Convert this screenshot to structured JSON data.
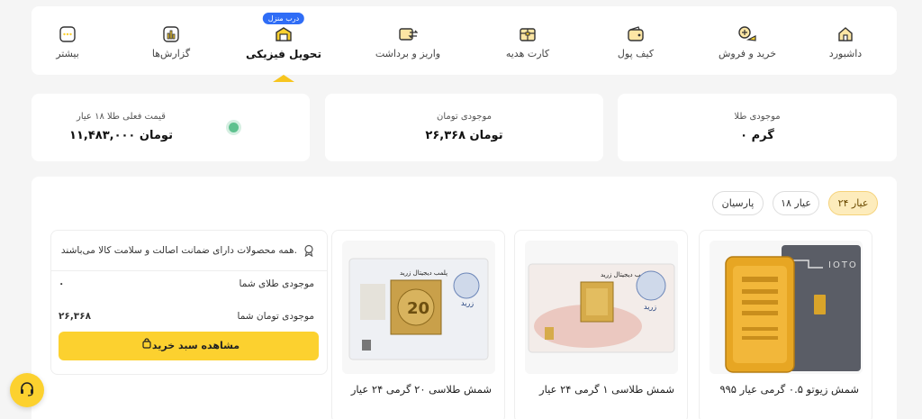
{
  "nav": {
    "items": [
      {
        "label": "داشبورد",
        "icon": "home-icon"
      },
      {
        "label": "خرید و فروش",
        "icon": "buy-sell-icon"
      },
      {
        "label": "کیف پول",
        "icon": "wallet-icon"
      },
      {
        "label": "کارت هدیه",
        "icon": "gift-card-icon"
      },
      {
        "label": "واریز و برداشت",
        "icon": "deposit-withdraw-icon"
      },
      {
        "label": "تحویل فیزیکی",
        "icon": "physical-delivery-icon",
        "badge": "درب منزل",
        "active": true
      },
      {
        "label": "گزارش‌ها",
        "icon": "reports-icon"
      },
      {
        "label": "بیشتر",
        "icon": "more-icon"
      }
    ]
  },
  "stats": {
    "gold_balance": {
      "title": "موجودی طلا",
      "value": "۰ گرم"
    },
    "toman_balance": {
      "title": "موجودی تومان",
      "value": "۲۶,۳۶۸ تومان"
    },
    "gold_price": {
      "title": "قیمت فعلی طلا ۱۸ عیار",
      "value": "۱۱,۴۸۳,۰۰۰ تومان"
    }
  },
  "filters": [
    {
      "label": "۲۴ عیار",
      "active": true
    },
    {
      "label": "۱۸ عیار"
    },
    {
      "label": "پارسیان"
    }
  ],
  "products": [
    {
      "name": "شمش زیوتو ۰.۵ گرمی عیار ۹۹۵",
      "image": "zioto-gold-bar-image"
    },
    {
      "name": "شمش طلاسی ۱ گرمی ۲۴ عیار",
      "image": "talasi-1g-bar-image"
    },
    {
      "name": "شمش طلاسی ۲۰ گرمی ۲۴ عیار",
      "image": "talasi-20g-bar-image"
    }
  ],
  "info": {
    "note": "همه محصولات دارای ضمانت اصالت و سلامت کالا می‌باشند.",
    "gold_label": "موجودی طلای شما",
    "gold_value": "۰",
    "toman_label": "موجودی تومان شما",
    "toman_value": "۲۶,۳۶۸",
    "button": "مشاهده سبد خرید"
  },
  "card_text": {
    "seal_title": "پلمب دیجیتال زرید",
    "brand": "زرید",
    "zioto_brand": "IOTO",
    "coin_number": "20"
  },
  "colors": {
    "accent": "#fcd12f",
    "badge": "#2f6df6",
    "live": "#5fc18f"
  }
}
